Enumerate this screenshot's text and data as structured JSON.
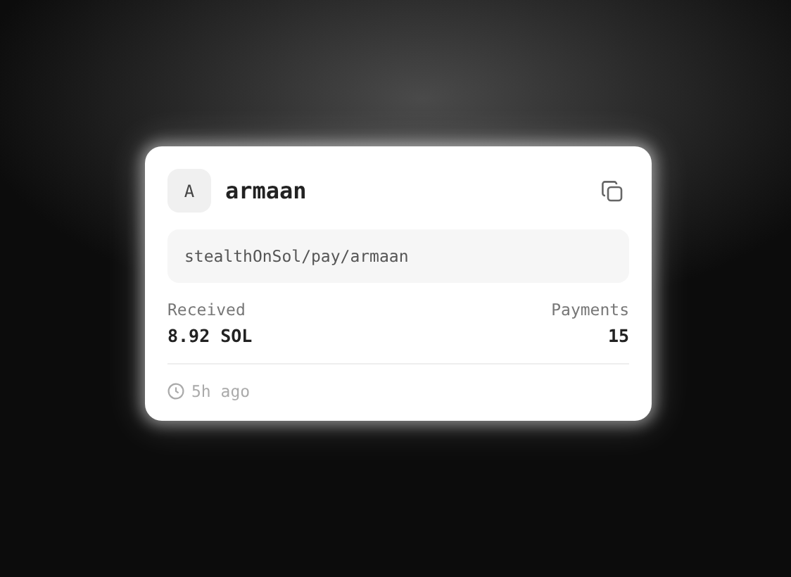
{
  "card": {
    "avatar": "A",
    "name": "armaan",
    "link": "stealthOnSol/pay/armaan",
    "stats": [
      {
        "label": "Received",
        "value": "8.92 SOL"
      },
      {
        "label": "Payments",
        "value": "15"
      }
    ],
    "time": "5h ago"
  }
}
